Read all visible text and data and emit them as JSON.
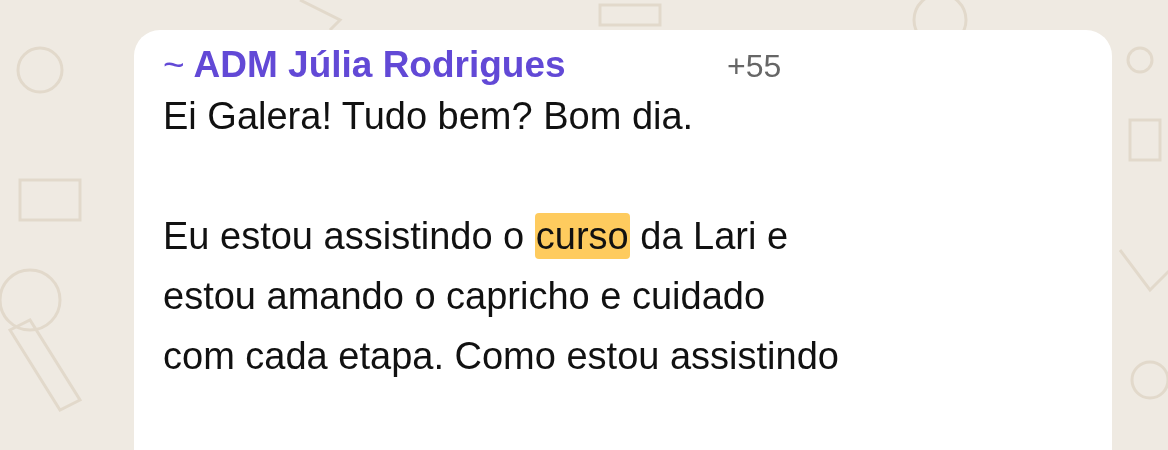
{
  "message": {
    "sender_prefix": "~",
    "sender": "ADM Júlia Rodrigues",
    "phone": "+55",
    "paragraphs": [
      [
        {
          "text": "Ei Galera! Tudo bem? Bom dia.",
          "highlighted": false
        }
      ],
      [
        {
          "text": "Eu estou assistindo o ",
          "highlighted": false
        },
        {
          "text": "curso",
          "highlighted": true
        },
        {
          "text": " da Lari e\nestou amando o capricho e cuidado\ncom cada etapa. Como estou assistindo",
          "highlighted": false
        }
      ]
    ]
  }
}
